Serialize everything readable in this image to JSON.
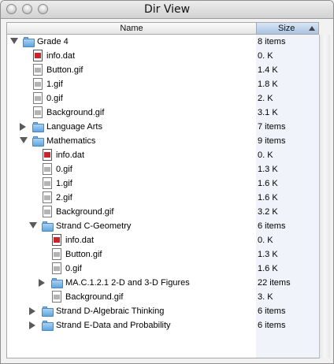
{
  "window": {
    "title": "Dir View"
  },
  "columns": {
    "name": "Name",
    "size": "Size"
  },
  "rows": [
    {
      "name": "Grade 4",
      "size": "8 items",
      "kind": "folder",
      "depth": 0,
      "toggle": "open"
    },
    {
      "name": "info.dat",
      "size": "0. K",
      "kind": "dat",
      "depth": 1,
      "toggle": "none"
    },
    {
      "name": "Button.gif",
      "size": "1.4 K",
      "kind": "file",
      "depth": 1,
      "toggle": "none"
    },
    {
      "name": "1.gif",
      "size": "1.8 K",
      "kind": "file",
      "depth": 1,
      "toggle": "none"
    },
    {
      "name": "0.gif",
      "size": "2. K",
      "kind": "file",
      "depth": 1,
      "toggle": "none"
    },
    {
      "name": "Background.gif",
      "size": "3.1 K",
      "kind": "file",
      "depth": 1,
      "toggle": "none"
    },
    {
      "name": "Language Arts",
      "size": "7 items",
      "kind": "folder",
      "depth": 1,
      "toggle": "closed"
    },
    {
      "name": "Mathematics",
      "size": "9 items",
      "kind": "folder",
      "depth": 1,
      "toggle": "open"
    },
    {
      "name": "info.dat",
      "size": "0. K",
      "kind": "dat",
      "depth": 2,
      "toggle": "none"
    },
    {
      "name": "0.gif",
      "size": "1.3 K",
      "kind": "file",
      "depth": 2,
      "toggle": "none"
    },
    {
      "name": "1.gif",
      "size": "1.6 K",
      "kind": "file",
      "depth": 2,
      "toggle": "none"
    },
    {
      "name": "2.gif",
      "size": "1.6 K",
      "kind": "file",
      "depth": 2,
      "toggle": "none"
    },
    {
      "name": "Background.gif",
      "size": "3.2 K",
      "kind": "file",
      "depth": 2,
      "toggle": "none"
    },
    {
      "name": "Strand C-Geometry",
      "size": "6 items",
      "kind": "folder",
      "depth": 2,
      "toggle": "open"
    },
    {
      "name": "info.dat",
      "size": "0. K",
      "kind": "dat",
      "depth": 3,
      "toggle": "none"
    },
    {
      "name": "Button.gif",
      "size": "1.3 K",
      "kind": "file",
      "depth": 3,
      "toggle": "none"
    },
    {
      "name": "0.gif",
      "size": "1.6 K",
      "kind": "file",
      "depth": 3,
      "toggle": "none"
    },
    {
      "name": "MA.C.1.2.1  2-D and 3-D Figures",
      "size": "22 items",
      "kind": "folder",
      "depth": 3,
      "toggle": "closed"
    },
    {
      "name": "Background.gif",
      "size": "3. K",
      "kind": "file",
      "depth": 3,
      "toggle": "none"
    },
    {
      "name": "Strand D-Algebraic Thinking",
      "size": "6 items",
      "kind": "folder",
      "depth": 2,
      "toggle": "closed"
    },
    {
      "name": "Strand E-Data and Probability",
      "size": "6 items",
      "kind": "folder",
      "depth": 2,
      "toggle": "closed"
    }
  ]
}
